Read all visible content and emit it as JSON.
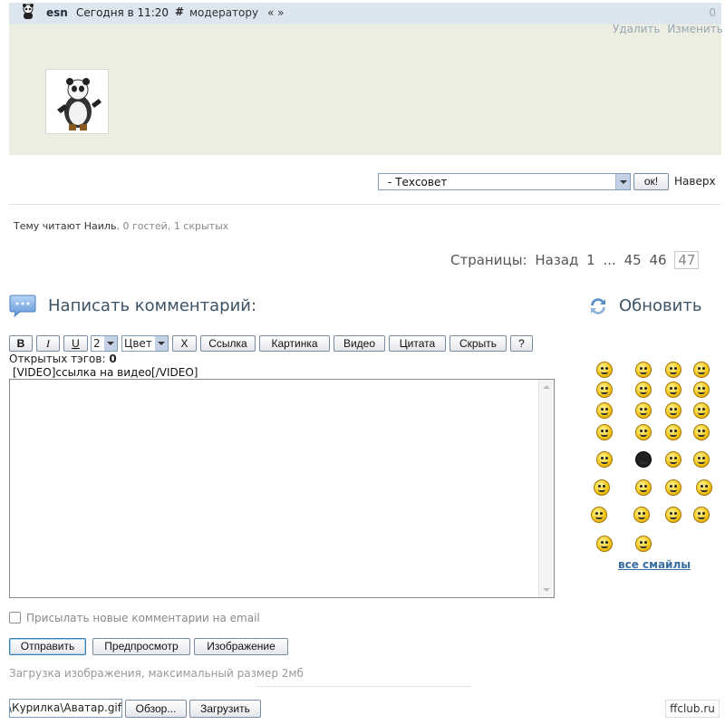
{
  "post": {
    "author": "esn",
    "time": "Сегодня в 11:20",
    "hash": "#",
    "moderator_link": "модератору",
    "quote_link": "« »",
    "count": "0",
    "actions": {
      "delete": "Удалить",
      "edit": "Изменить"
    }
  },
  "forum_jump": {
    "selected": "- Техсовет",
    "ok_label": "ок!",
    "to_top": "Наверх"
  },
  "readers": {
    "prefix": "Тему читают",
    "user": "Наиль",
    "rest": ", 0 гостей, 1 скрытых"
  },
  "pagination": {
    "label": "Страницы:",
    "back": "Назад",
    "pages": [
      "1",
      "...",
      "45",
      "46"
    ],
    "current": "47"
  },
  "comment": {
    "title": "Написать комментарий:",
    "refresh": "Обновить"
  },
  "toolbar": {
    "bold": "B",
    "italic": "I",
    "underline": "U",
    "size_value": "2",
    "color_value": "Цвет",
    "strike": "X",
    "link": "Ссылка",
    "picture": "Картинка",
    "video": "Видео",
    "quote": "Цитата",
    "spoiler": "Скрыть",
    "help": "?"
  },
  "open_tags": {
    "label": "Открытых тэгов:",
    "count": "0"
  },
  "video_hint": "[VIDEO]ссылка на видео[/VIDEO]",
  "textarea": {
    "value": ""
  },
  "smileys": {
    "all_label": "все смайлы",
    "count": 30
  },
  "email_option": {
    "label": "Присылать новые комментарии на email",
    "checked": false
  },
  "buttons": {
    "send": "Отправить",
    "preview": "Предпросмотр",
    "image": "Изображение"
  },
  "upload": {
    "note": "Загрузка изображения, максимальный размер 2мб",
    "file_value": "C:\\Картинки\\Курилка\\Аватар.gif\"",
    "browse": "Обзор...",
    "upload": "Загрузить"
  },
  "watermark": "ffclub.ru",
  "colors": {
    "header_bg": "#dde6ee",
    "body_bg": "#eceee2",
    "title": "#3d5366",
    "link": "#3a6da3"
  }
}
